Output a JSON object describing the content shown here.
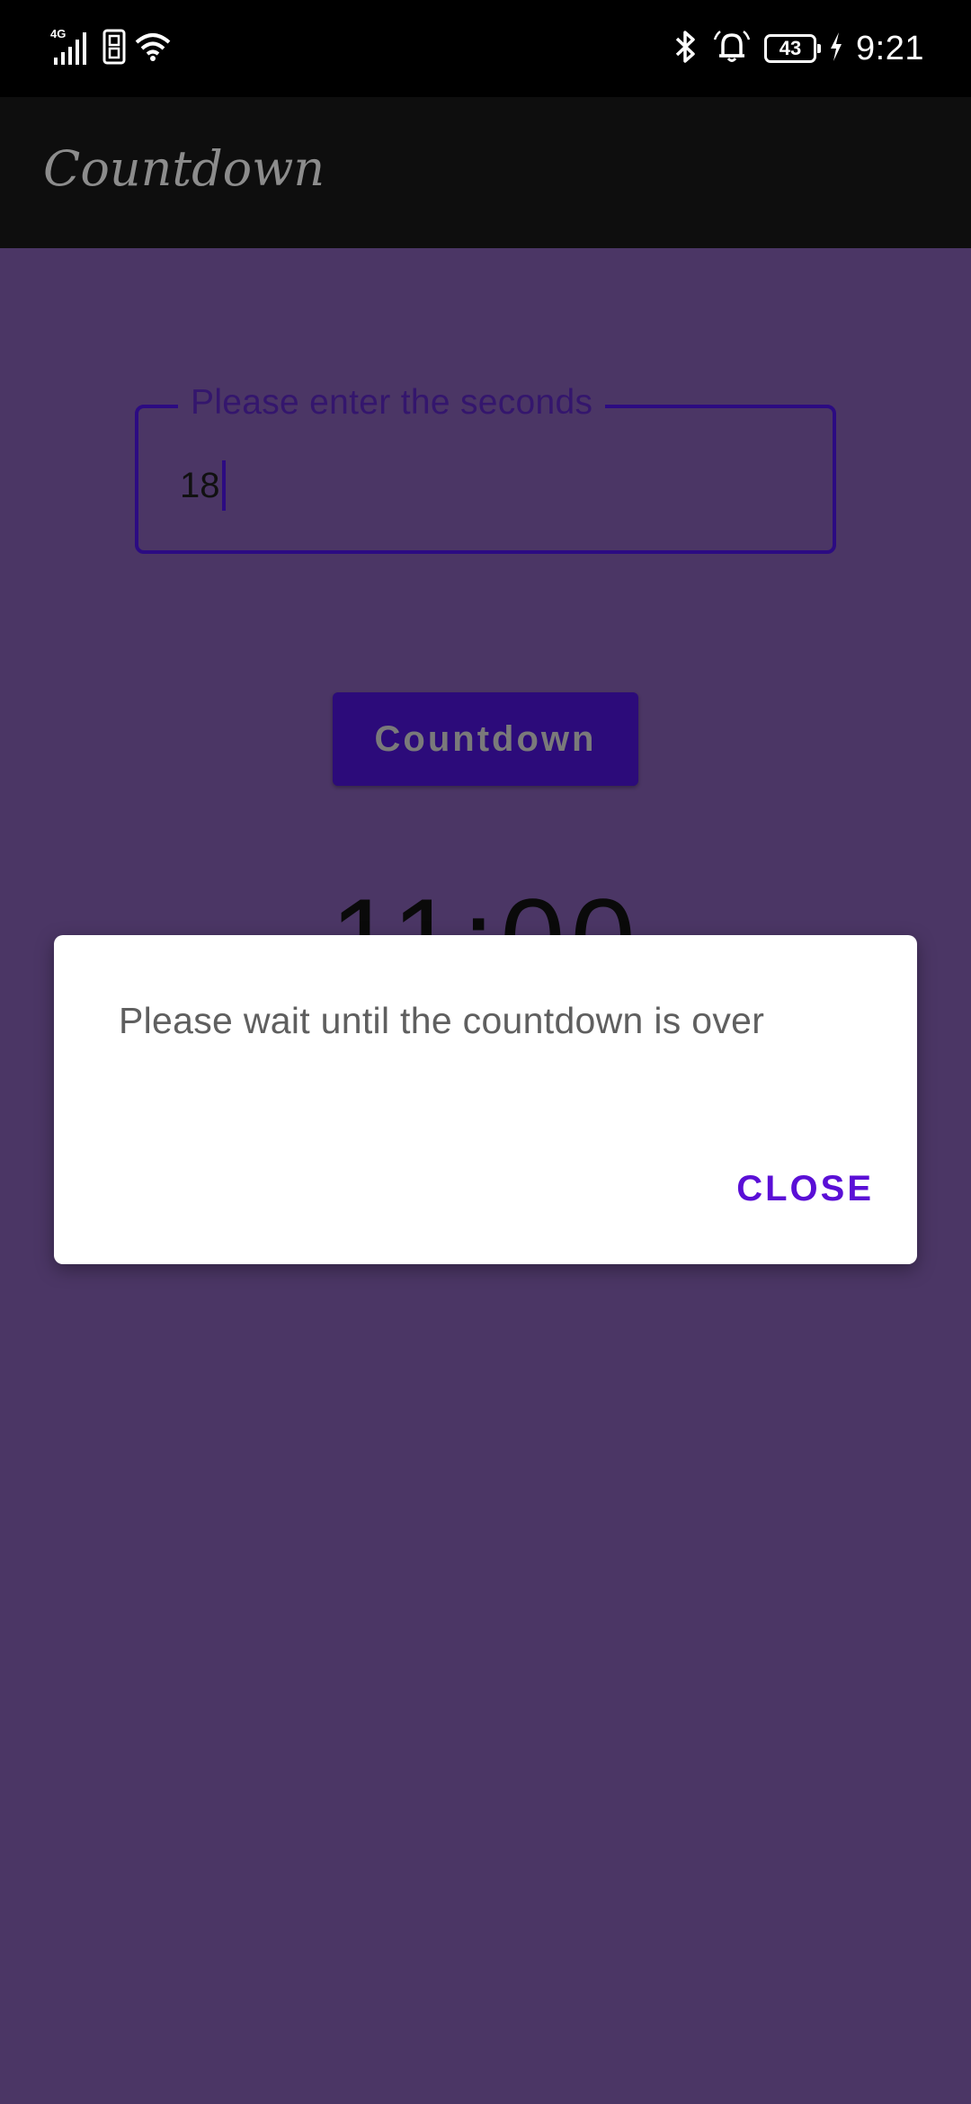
{
  "status_bar": {
    "network": "4G",
    "battery": "43",
    "time": "9:21",
    "icons": [
      "signal-icon",
      "sim-icon",
      "wifi-icon",
      "bluetooth-icon",
      "alarm-icon",
      "battery-icon",
      "charging-icon"
    ]
  },
  "app_bar": {
    "title": "Countdown"
  },
  "form": {
    "input_label": "Please enter the seconds",
    "input_value": "18",
    "button_label": "Countdown"
  },
  "timer": {
    "display": "11:00"
  },
  "dialog": {
    "message": "Please wait until the countdown is over",
    "close_label": "CLOSE"
  },
  "colors": {
    "background": "#4b3665",
    "app_bar": "#0e0e0e",
    "accent": "#2c0b82",
    "dialog_action": "#5a0fd6"
  }
}
